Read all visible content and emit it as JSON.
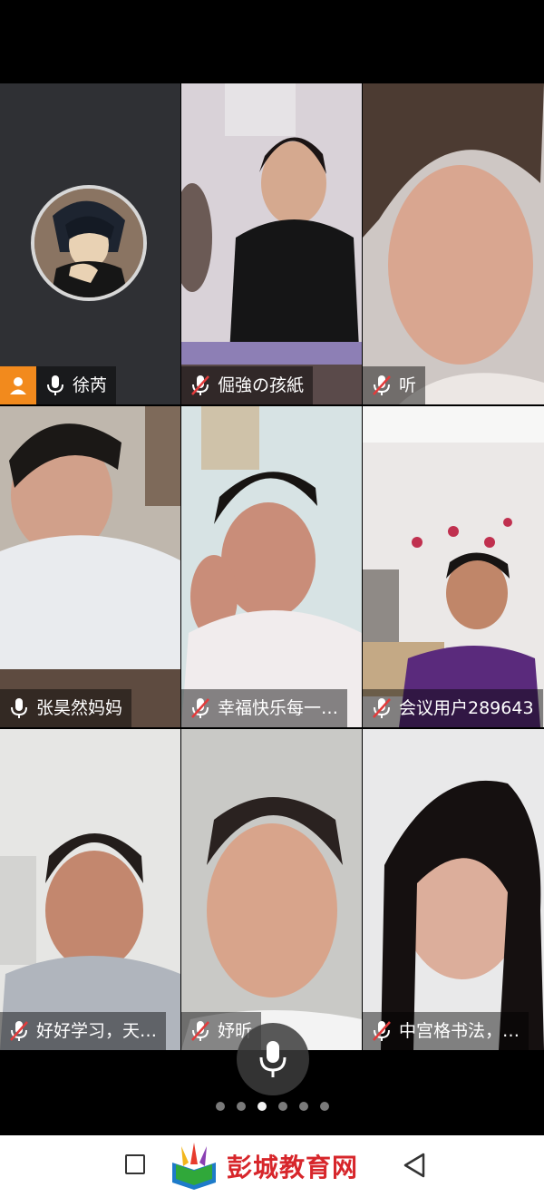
{
  "participants": [
    {
      "name": "徐芮",
      "mic": "on",
      "host": true,
      "has_avatar": true
    },
    {
      "name": "倔強の孩紙",
      "mic": "muted"
    },
    {
      "name": "听",
      "mic": "muted"
    },
    {
      "name": "张昊然妈妈",
      "mic": "on"
    },
    {
      "name": "幸福快乐每一…",
      "mic": "muted"
    },
    {
      "name": "会议用户289643",
      "mic": "muted"
    },
    {
      "name": "好好学习，天…",
      "mic": "muted"
    },
    {
      "name": "妤昕",
      "mic": "muted"
    },
    {
      "name": "中宫格书法，…",
      "mic": "muted"
    }
  ],
  "pager": {
    "total": 6,
    "active_index": 2
  },
  "watermark": {
    "text": "彭城教育网"
  },
  "colors": {
    "host_badge": "#f28a1d",
    "muted_red": "#e23b3b",
    "watermark": "#d7262b"
  }
}
